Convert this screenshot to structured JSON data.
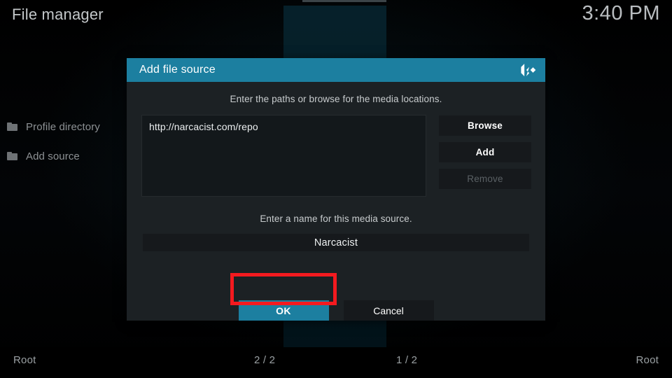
{
  "window": {
    "title": "File manager",
    "clock": "3:40 PM"
  },
  "sidebar": {
    "items": [
      {
        "icon": "folder-icon",
        "label": "Profile directory"
      },
      {
        "icon": "folder-icon",
        "label": "Add source"
      }
    ]
  },
  "statusbar": {
    "left_label": "Root",
    "left_count": "2 / 2",
    "right_count": "1 / 2",
    "right_label": "Root"
  },
  "dialog": {
    "title": "Add file source",
    "logo_icon": "kodi-logo-icon",
    "paths_hint": "Enter the paths or browse for the media locations.",
    "path_entries": [
      "http://narcacist.com/repo"
    ],
    "side_buttons": [
      {
        "label": "Browse",
        "disabled": false
      },
      {
        "label": "Add",
        "disabled": false
      },
      {
        "label": "Remove",
        "disabled": true
      }
    ],
    "name_hint": "Enter a name for this media source.",
    "name_value": "Narcacist",
    "actions": [
      {
        "label": "OK",
        "focused": true
      },
      {
        "label": "Cancel",
        "focused": false
      }
    ]
  },
  "annotation": {
    "type": "highlight-rectangle",
    "target": "ok-button",
    "color": "#f41a1f"
  },
  "colors": {
    "accent_teal": "#1c7fa0",
    "dialog_bg": "#1c2124",
    "field_bg": "#16191c",
    "annotation_red": "#f41a1f"
  }
}
